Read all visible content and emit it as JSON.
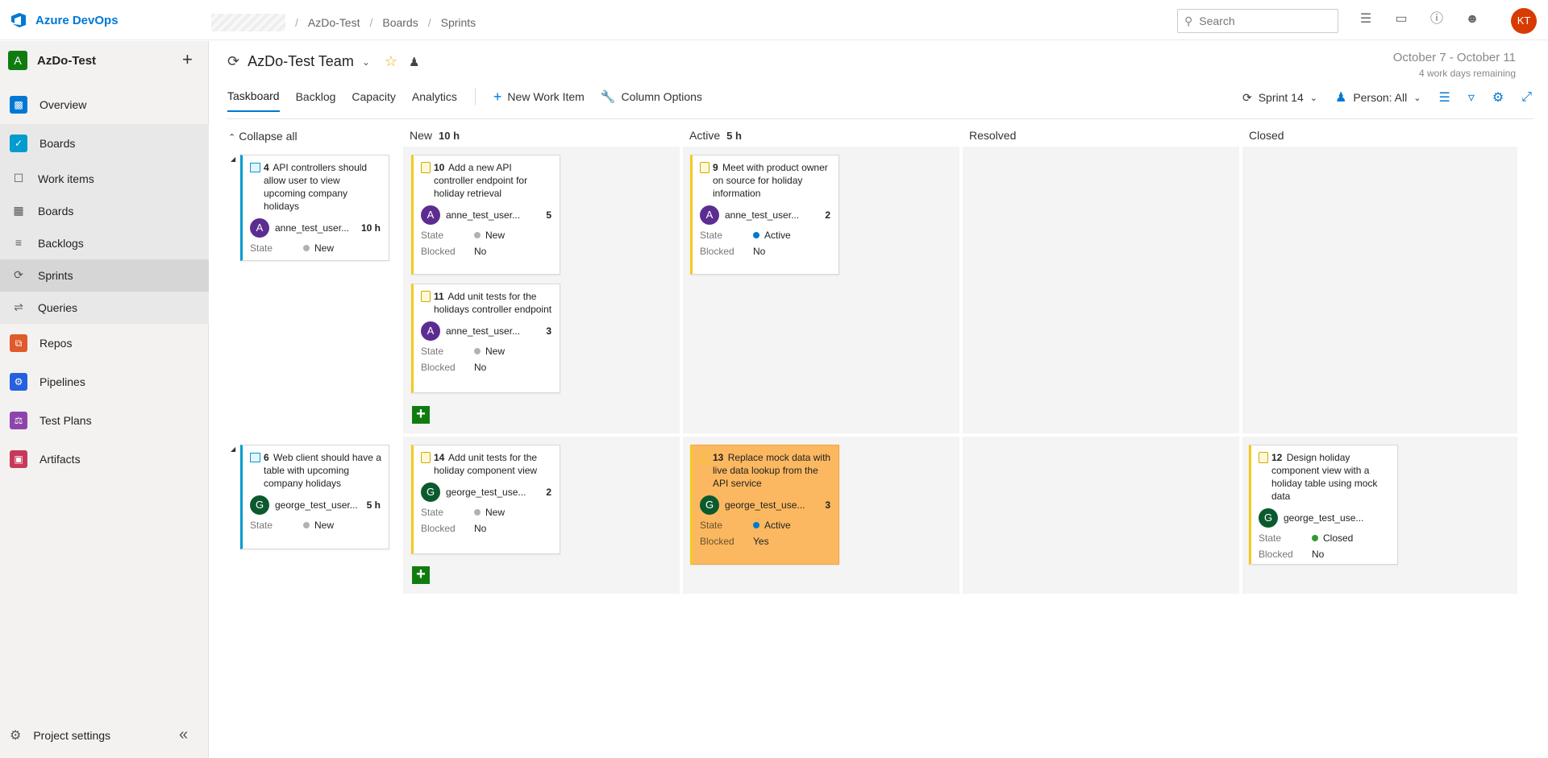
{
  "topbar": {
    "brand": "Azure DevOps",
    "breadcrumb": [
      "AzDo-Test",
      "Boards",
      "Sprints"
    ],
    "search_placeholder": "Search",
    "user_initials": "KT"
  },
  "sidebar": {
    "project_initial": "A",
    "project_name": "AzDo-Test",
    "items": [
      {
        "label": "Overview"
      },
      {
        "label": "Boards"
      },
      {
        "label": "Work items"
      },
      {
        "label": "Boards"
      },
      {
        "label": "Backlogs"
      },
      {
        "label": "Sprints"
      },
      {
        "label": "Queries"
      },
      {
        "label": "Repos"
      },
      {
        "label": "Pipelines"
      },
      {
        "label": "Test Plans"
      },
      {
        "label": "Artifacts"
      }
    ],
    "settings_label": "Project settings"
  },
  "header": {
    "team_name": "AzDo-Test Team",
    "date_range": "October 7 - October 11",
    "work_days": "4 work days remaining"
  },
  "tabs": [
    "Taskboard",
    "Backlog",
    "Capacity",
    "Analytics"
  ],
  "toolbar": {
    "new_item": "New Work Item",
    "column_options": "Column Options",
    "sprint": "Sprint 14",
    "person": "Person: All"
  },
  "board": {
    "collapse_all": "Collapse all",
    "columns": [
      {
        "name": "New",
        "hours": "10 h"
      },
      {
        "name": "Active",
        "hours": "5 h"
      },
      {
        "name": "Resolved",
        "hours": ""
      },
      {
        "name": "Closed",
        "hours": ""
      }
    ],
    "field_labels": {
      "state": "State",
      "blocked": "Blocked"
    },
    "rows": [
      {
        "story": {
          "id": "4",
          "title": "API controllers should allow user to view upcoming company holidays",
          "owner": "anne_test_user...",
          "owner_initial": "A",
          "remaining": "10 h",
          "state": "New"
        },
        "tasks": [
          {
            "id": "10",
            "title": "Add a new API controller endpoint for holiday retrieval",
            "owner": "anne_test_user...",
            "owner_initial": "A",
            "remaining": "5",
            "state": "New",
            "blocked": "No"
          },
          {
            "id": "11",
            "title": "Add unit tests for the holidays controller endpoint",
            "owner": "anne_test_user...",
            "owner_initial": "A",
            "remaining": "3",
            "state": "New",
            "blocked": "No"
          },
          {
            "id": "9",
            "title": "Meet with product owner on source for holiday information",
            "owner": "anne_test_user...",
            "owner_initial": "A",
            "remaining": "2",
            "state": "Active",
            "blocked": "No"
          }
        ]
      },
      {
        "story": {
          "id": "6",
          "title": "Web client should have a table with upcoming company holidays",
          "owner": "george_test_user...",
          "owner_initial": "G",
          "remaining": "5 h",
          "state": "New"
        },
        "tasks": [
          {
            "id": "14",
            "title": "Add unit tests for the holiday component view",
            "owner": "george_test_use...",
            "owner_initial": "G",
            "remaining": "2",
            "state": "New",
            "blocked": "No"
          },
          {
            "id": "13",
            "title": "Replace mock data with live data lookup from the API service",
            "owner": "george_test_use...",
            "owner_initial": "G",
            "remaining": "3",
            "state": "Active",
            "blocked": "Yes"
          },
          {
            "id": "12",
            "title": "Design holiday component view with a holiday table using mock data",
            "owner": "george_test_use...",
            "owner_initial": "G",
            "remaining": "",
            "state": "Closed",
            "blocked": "No"
          }
        ]
      }
    ]
  },
  "colors": {
    "accent": "#0078d4",
    "new": "#b2b2b2",
    "active": "#007acc",
    "closed": "#339933",
    "blocked_card": "#fbb860",
    "task_bar": "#f2cb1d",
    "story_bar": "#009ccc"
  }
}
